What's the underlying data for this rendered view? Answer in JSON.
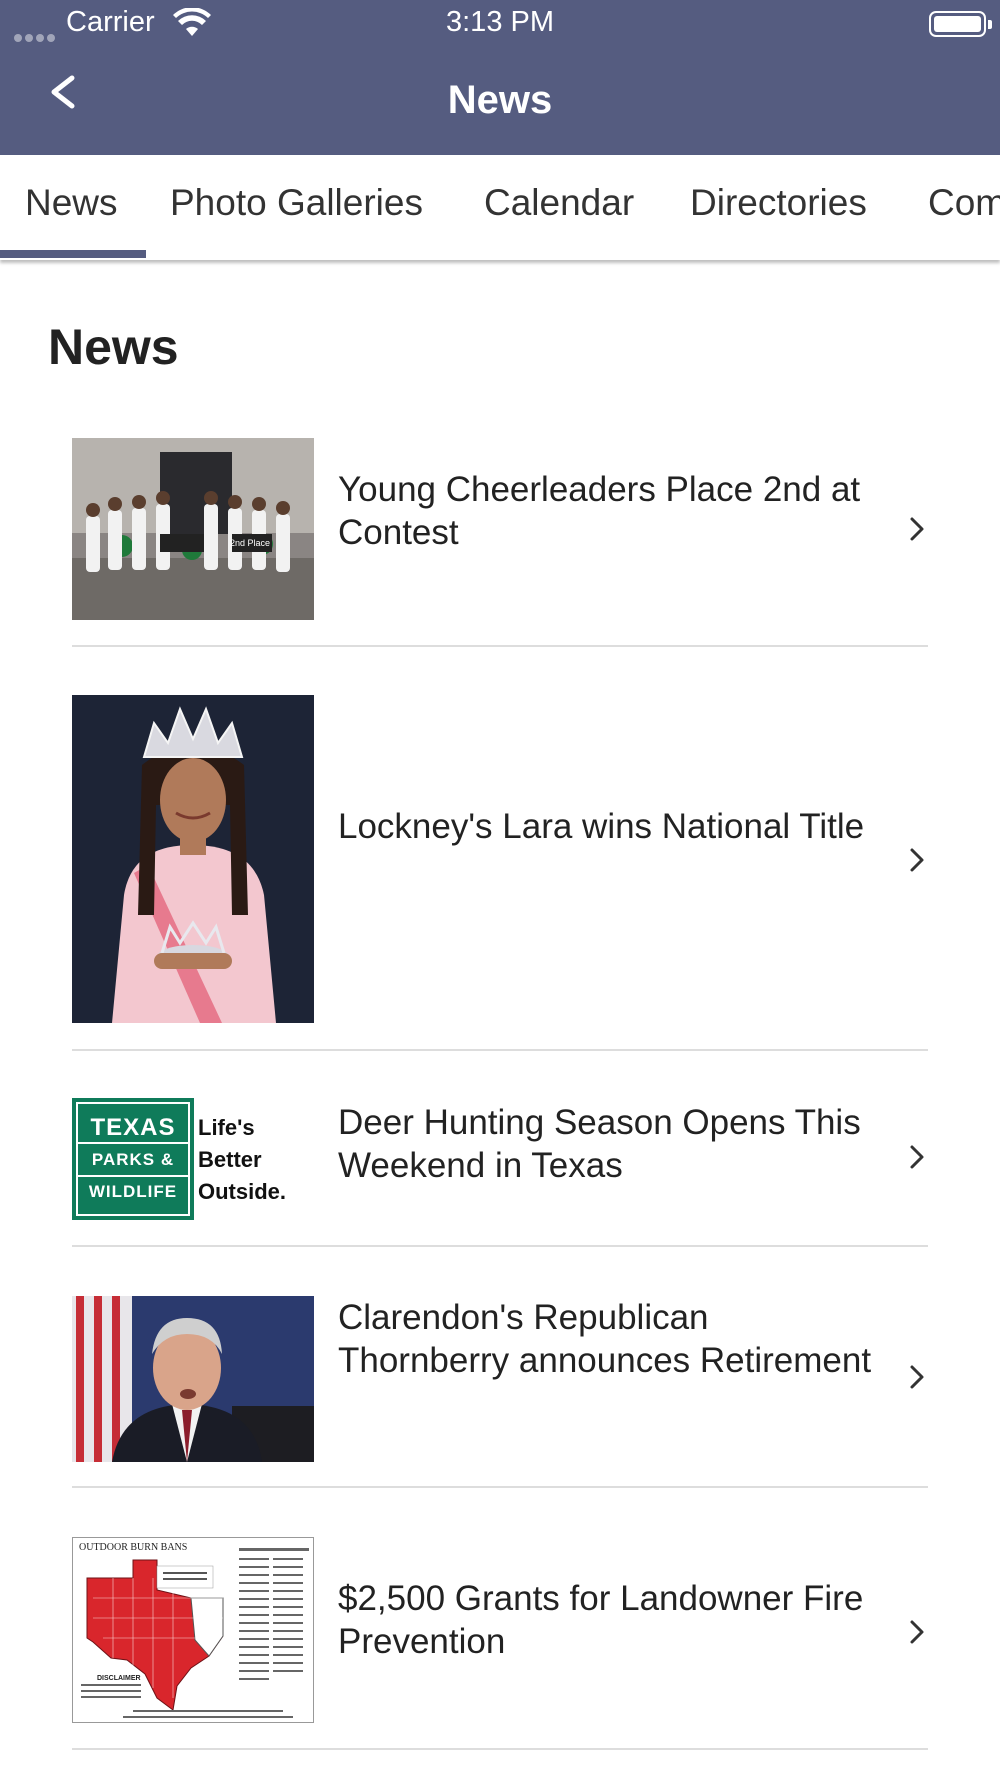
{
  "status_bar": {
    "carrier": "Carrier",
    "time": "3:13 PM"
  },
  "nav": {
    "back_label": "<",
    "title": "News"
  },
  "tabs": [
    {
      "label": "News",
      "active": true
    },
    {
      "label": "Photo Galleries",
      "active": false
    },
    {
      "label": "Calendar",
      "active": false
    },
    {
      "label": "Directories",
      "active": false
    },
    {
      "label": "Com",
      "active": false
    }
  ],
  "page": {
    "heading": "News"
  },
  "news": [
    {
      "headline": "Young Cheerleaders Place 2nd at Contest",
      "thumb": "cheerleaders-photo"
    },
    {
      "headline": "Lockney's Lara wins National Title",
      "thumb": "pageant-photo"
    },
    {
      "headline": "Deer Hunting Season Opens This Weekend in Texas",
      "thumb": "texas-parks-wildlife-logo"
    },
    {
      "headline": "Clarendon's Republican Thornberry announces Retirement",
      "thumb": "congressman-photo"
    },
    {
      "headline": "$2,500 Grants for Landowner Fire Prevention",
      "thumb": "burn-ban-map"
    }
  ],
  "logo_texts": {
    "tpw_texas": "TEXAS",
    "tpw_parks": "PARKS &",
    "tpw_wildlife": "WILDLIFE",
    "tpw_slogan1": "Life's",
    "tpw_slogan2": "Better",
    "tpw_slogan3": "Outside.",
    "map_title": "OUTDOOR BURN BANS",
    "map_disclaimer": "DISCLAIMER",
    "cheer_sign": "2nd Place"
  },
  "colors": {
    "nav_bg": "#555c80",
    "tab_indicator": "#555c80",
    "divider": "#dddddd",
    "tpw_green": "#0f7b5a",
    "burn_red": "#d9262c"
  }
}
